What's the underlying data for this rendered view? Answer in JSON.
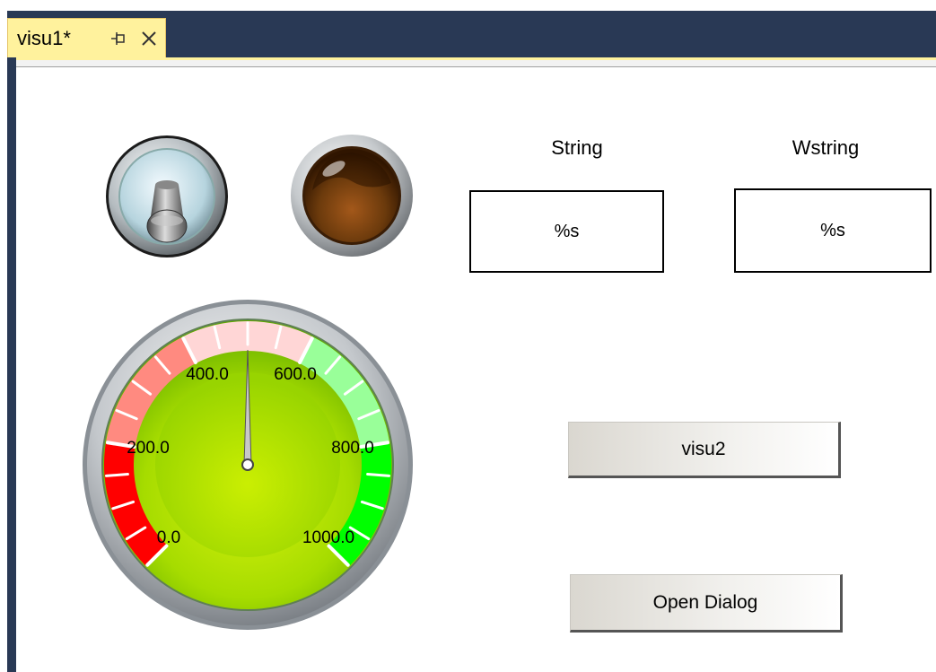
{
  "tab": {
    "title": "visu1*",
    "pin_icon": "pin-icon",
    "close_icon": "close-icon"
  },
  "controls": {
    "string_label": "String",
    "wstring_label": "Wstring",
    "string_value": "%s",
    "wstring_value": "%s",
    "visu2_button": "visu2",
    "open_dialog_button": "Open Dialog"
  },
  "gauge": {
    "min": 0,
    "max": 1000,
    "value": 500,
    "scale_labels": [
      "0.0",
      "200.0",
      "400.0",
      "600.0",
      "800.0",
      "1000.0"
    ],
    "colors": {
      "low": "#ff0000",
      "mid_low": "#ff8a80",
      "mid": "#ffd6d6",
      "high": "#99ff99",
      "very_high": "#00ff00",
      "face": "#aadf00"
    }
  },
  "toggle_switch": {
    "icon": "toggle-switch-icon"
  },
  "lamp": {
    "icon": "lamp-icon",
    "color": "#6b3a0c"
  }
}
